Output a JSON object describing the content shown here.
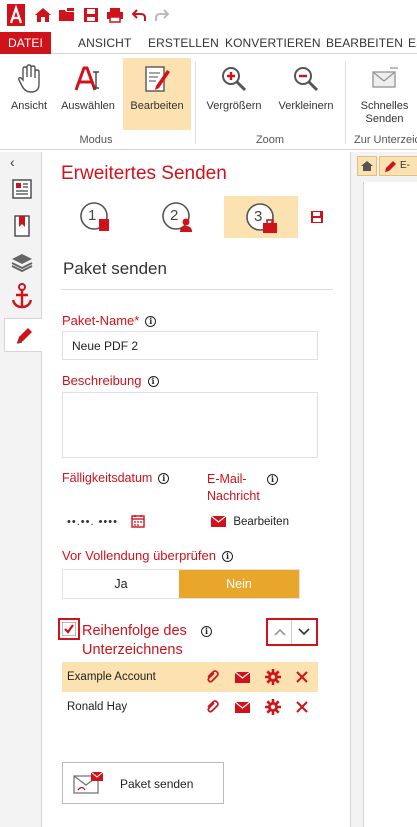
{
  "app": {
    "accent": "#d0121b",
    "selected_bg": "#fbe2b0",
    "toggle_active": "#e8a72b"
  },
  "tabs": [
    "DATEI",
    "ANSICHT",
    "ERSTELLEN",
    "KONVERTIEREN",
    "BEARBEITEN",
    "ES"
  ],
  "ribbon": {
    "modus": {
      "ansicht": "Ansicht",
      "auswaehlen": "Auswählen",
      "bearbeiten": "Bearbeiten",
      "group": "Modus"
    },
    "zoom": {
      "vergroessern": "Vergrößern",
      "verkleinern": "Verkleinern",
      "group": "Zoom"
    },
    "schnelles_senden": "Schnelles Senden",
    "schnelles_line1": "Schnelles",
    "schnelles_line2": "Senden",
    "unterz_group": "Zur Unterzeic"
  },
  "doc_tab": "E-",
  "panel": {
    "title": "Erweitertes Senden",
    "steps": [
      "1",
      "2",
      "3"
    ],
    "section_title": "Paket senden",
    "paket_name_label": "Paket-Name",
    "required_mark": "*",
    "paket_name_value": "Neue PDF 2",
    "beschreibung_label": "Beschreibung",
    "beschreibung_value": "",
    "faelligkeit_label": "Fälligkeitsdatum",
    "faelligkeit_value": "••.••. ••••",
    "email_label_line1": "E-Mail-",
    "email_label_line2": "Nachricht",
    "email_edit": "Bearbeiten",
    "vor_vollendung_label": "Vor Vollendung überprüfen",
    "toggle_ja": "Ja",
    "toggle_nein": "Nein",
    "reihenfolge_line1": "Reihenfolge des",
    "reihenfolge_line2": "Unterzeichnens",
    "signers": [
      {
        "name": "Example Account"
      },
      {
        "name": "Ronald Hay"
      }
    ],
    "send_button": "Paket senden",
    "info_glyph": "i"
  }
}
